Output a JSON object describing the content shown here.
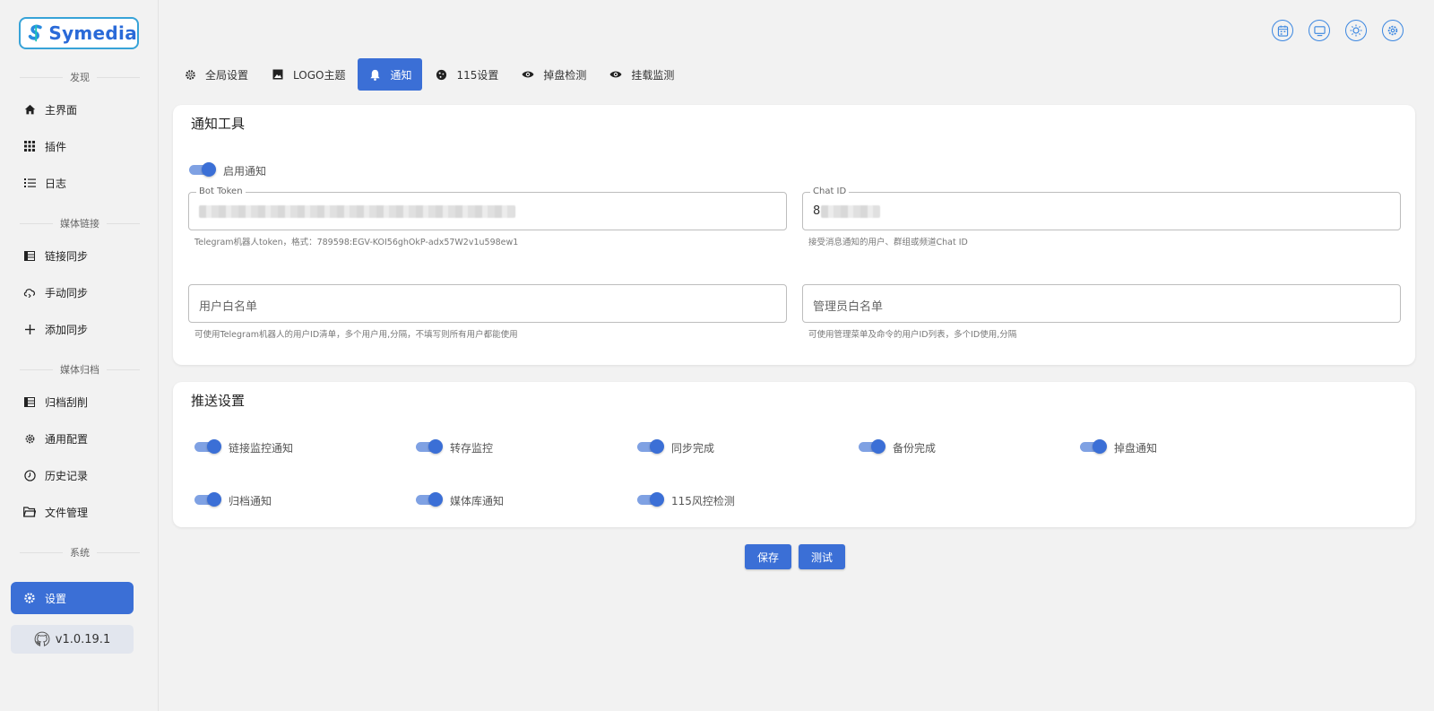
{
  "app": {
    "logo_text": "Symedia",
    "version": "v1.0.19.1"
  },
  "sidebar": {
    "sections": [
      "发现",
      "媒体链接",
      "媒体归档",
      "系统"
    ],
    "items": [
      {
        "label": "主界面",
        "icon": "home-icon"
      },
      {
        "label": "插件",
        "icon": "grid-icon"
      },
      {
        "label": "日志",
        "icon": "list-icon"
      },
      {
        "label": "链接同步",
        "icon": "table-icon"
      },
      {
        "label": "手动同步",
        "icon": "cloud-sync-icon"
      },
      {
        "label": "添加同步",
        "icon": "plus-icon"
      },
      {
        "label": "归档刮削",
        "icon": "table-icon"
      },
      {
        "label": "通用配置",
        "icon": "gear-icon"
      },
      {
        "label": "历史记录",
        "icon": "clock-icon"
      },
      {
        "label": "文件管理",
        "icon": "folder-icon"
      },
      {
        "label": "设置",
        "icon": "gear-icon",
        "active": true
      }
    ]
  },
  "tabs": [
    {
      "label": "全局设置",
      "icon": "gear-icon"
    },
    {
      "label": "LOGO主题",
      "icon": "image-icon"
    },
    {
      "label": "通知",
      "icon": "bell-icon",
      "active": true
    },
    {
      "label": "115设置",
      "icon": "cookie-icon"
    },
    {
      "label": "掉盘检测",
      "icon": "eye-icon"
    },
    {
      "label": "挂载监测",
      "icon": "eye-icon"
    }
  ],
  "notify_card": {
    "title": "通知工具",
    "enable_label": "启用通知",
    "bot_token": {
      "legend": "Bot Token",
      "hint": "Telegram机器人token，格式：789598:EGV-KOI56ghOkP-adx57W2v1u598ew1"
    },
    "chat_id": {
      "legend": "Chat ID",
      "value_prefix": "8",
      "hint": "接受消息通知的用户、群组或频道Chat ID"
    },
    "user_whitelist": {
      "placeholder": "用户白名单",
      "hint": "可使用Telegram机器人的用户ID清单，多个用户用,分隔，不填写则所有用户都能使用"
    },
    "admin_whitelist": {
      "placeholder": "管理员白名单",
      "hint": "可使用管理菜单及命令的用户ID列表，多个ID使用,分隔"
    }
  },
  "push_card": {
    "title": "推送设置",
    "switches": [
      "链接监控通知",
      "转存监控",
      "同步完成",
      "备份完成",
      "掉盘通知",
      "归档通知",
      "媒体库通知",
      "115风控检测"
    ]
  },
  "buttons": {
    "save": "保存",
    "test": "测试"
  },
  "colors": {
    "accent": "#3b6fd6",
    "icon_ring": "#3a86e0"
  }
}
